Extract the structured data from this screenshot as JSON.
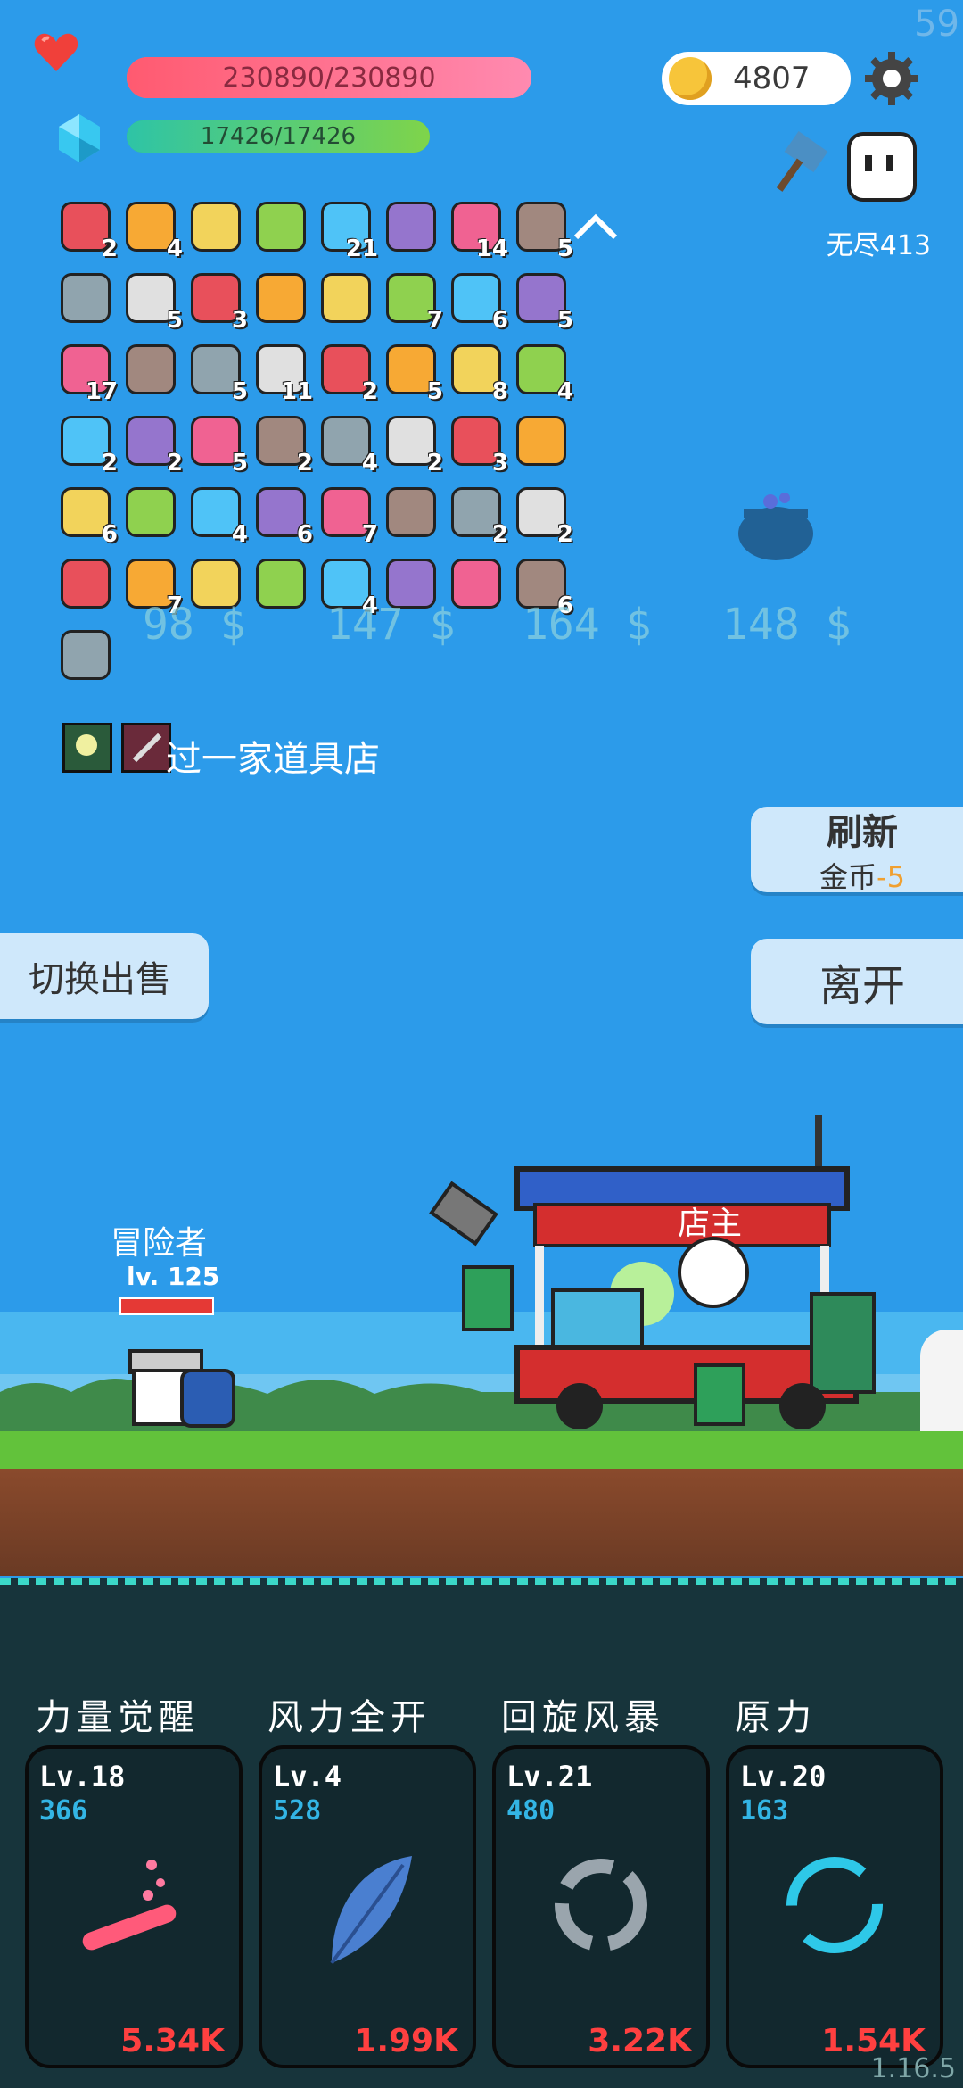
{
  "hud": {
    "hp_text": "230890/230890",
    "hp_fraction": 1.0,
    "mp_text": "17426/17426",
    "mp_fraction": 1.0,
    "coins": "4807",
    "endless_label": "无尽413",
    "fps": "59",
    "version": "1.16.5"
  },
  "inventory": [
    {
      "icon": "jam-jar-icon",
      "count": "2"
    },
    {
      "icon": "red-sock-icon",
      "count": "4"
    },
    {
      "icon": "scroll-icon",
      "count": ""
    },
    {
      "icon": "sword-icon",
      "count": ""
    },
    {
      "icon": "sun-cloud-icon",
      "count": "21"
    },
    {
      "icon": "pearl-chain-icon",
      "count": ""
    },
    {
      "icon": "shield-icon",
      "count": "14"
    },
    {
      "icon": "lightbulb-icon",
      "count": "5"
    },
    {
      "icon": "heart-card-icon",
      "count": ""
    },
    {
      "icon": "ice-cream-icon",
      "count": "5"
    },
    {
      "icon": "grenade-icon",
      "count": "3"
    },
    {
      "icon": "potion-icon",
      "count": ""
    },
    {
      "icon": "viking-helmet-icon",
      "count": ""
    },
    {
      "icon": "coconut-icon",
      "count": "7"
    },
    {
      "icon": "bat-icon",
      "count": "6"
    },
    {
      "icon": "goblin-icon",
      "count": "5"
    },
    {
      "icon": "crown-icon",
      "count": "17"
    },
    {
      "icon": "meat-icon",
      "count": ""
    },
    {
      "icon": "axe-icon",
      "count": "5"
    },
    {
      "icon": "money-heart-icon",
      "count": "11"
    },
    {
      "icon": "jade-figure-icon",
      "count": "2"
    },
    {
      "icon": "flask-icon",
      "count": "5"
    },
    {
      "icon": "ring-target-icon",
      "count": "8"
    },
    {
      "icon": "round-shield-icon",
      "count": "4"
    },
    {
      "icon": "ring-icon",
      "count": "2"
    },
    {
      "icon": "magic-wand-icon",
      "count": "2"
    },
    {
      "icon": "lime-icon",
      "count": "5"
    },
    {
      "icon": "sunflower-icon",
      "count": "2"
    },
    {
      "icon": "ghost-icon",
      "count": "4"
    },
    {
      "icon": "meteor-icon",
      "count": "2"
    },
    {
      "icon": "purple-box-icon",
      "count": "3"
    },
    {
      "icon": "fist-icon",
      "count": ""
    },
    {
      "icon": "mushroom-icon",
      "count": "6"
    },
    {
      "icon": "noose-icon",
      "count": ""
    },
    {
      "icon": "star-shield-icon",
      "count": "4"
    },
    {
      "icon": "star-card-icon",
      "count": "6"
    },
    {
      "icon": "compass-icon",
      "count": "7"
    },
    {
      "icon": "red-shield-icon",
      "count": ""
    },
    {
      "icon": "map-icon",
      "count": "2"
    },
    {
      "icon": "cloud-icon",
      "count": "2"
    },
    {
      "icon": "envelope-icon",
      "count": ""
    },
    {
      "icon": "fried-egg-icon",
      "count": "7"
    },
    {
      "icon": "bow-icon",
      "count": ""
    },
    {
      "icon": "hearts-icon",
      "count": ""
    },
    {
      "icon": "tombstone-icon",
      "count": "4"
    },
    {
      "icon": "watermelon-icon",
      "count": ""
    },
    {
      "icon": "mace-icon",
      "count": ""
    },
    {
      "icon": "coin-stack-icon",
      "count": "6"
    },
    {
      "icon": "playing-cards-icon",
      "count": ""
    }
  ],
  "shop_prices": [
    "98 $",
    "147 $",
    "164 $",
    "148 $"
  ],
  "message": "过一家道具店",
  "buttons": {
    "refresh_title": "刷新",
    "refresh_cost_label": "金币",
    "refresh_cost_value": "-5",
    "leave": "离开",
    "switch_sell": "切换出售"
  },
  "scene": {
    "player_name": "冒险者",
    "player_level": "lv. 125",
    "shop_sign": "店主"
  },
  "skills": [
    {
      "title": "力量觉醒",
      "level": "Lv.18",
      "cost": "366",
      "damage": "5.34K",
      "icon": "test-tube-icon"
    },
    {
      "title": "风力全开",
      "level": "Lv.4",
      "cost": "528",
      "damage": "1.99K",
      "icon": "feather-icon"
    },
    {
      "title": "回旋风暴",
      "level": "Lv.21",
      "cost": "480",
      "damage": "3.22K",
      "icon": "gray-cycle-icon"
    },
    {
      "title": "原力",
      "level": "Lv.20",
      "cost": "163",
      "damage": "1.54K",
      "icon": "blue-cycle-icon"
    }
  ],
  "colors": {
    "sky": "#2c9bea",
    "hp": "#ff6f7f",
    "mp": "#38b57a",
    "skill_cost": "#33b5e5",
    "skill_damage": "#ff4040",
    "refresh_cost": "#f0a030"
  }
}
